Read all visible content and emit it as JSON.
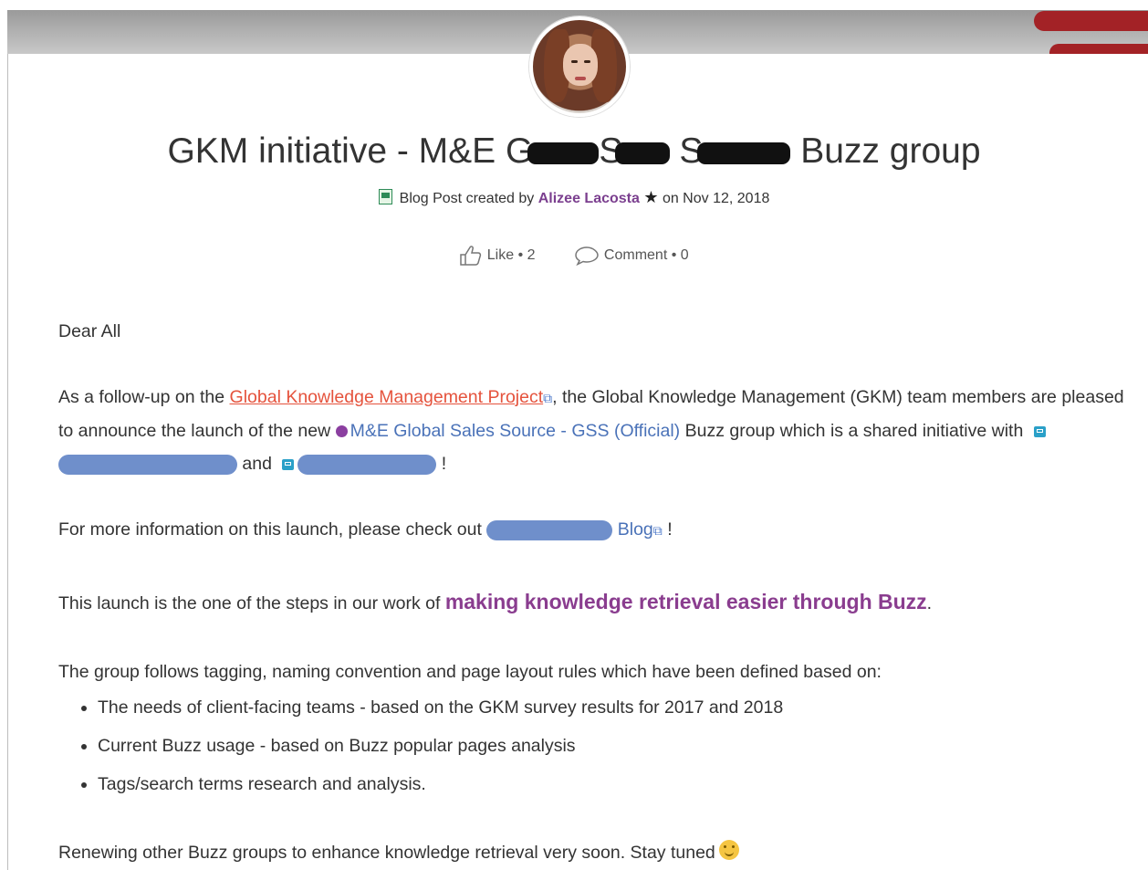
{
  "post": {
    "title_parts": [
      "GKM initiative - M&E G",
      "S",
      "S",
      " Buzz group"
    ],
    "meta_prefix": "Blog Post created by",
    "author": "Alizee Lacosta",
    "meta_date": "on Nov 12, 2018"
  },
  "social": {
    "like_label": "Like",
    "like_count": "2",
    "comment_label": "Comment",
    "comment_count": "0",
    "separator": "•"
  },
  "body": {
    "greeting": "Dear All",
    "p1_a": "As a follow-up on the ",
    "p1_link": "Global Knowledge Management Project",
    "p1_b": ", the Global Knowledge Management (GKM) team members are pleased to announce the launch of the new ",
    "p1_group": "M&E Global Sales Source - GSS (Official)",
    "p1_c": " Buzz group which is a shared initiative with ",
    "p1_and": " and ",
    "p1_end": " !",
    "p2_a": "For more information on this launch, please check out ",
    "p2_blog": "Blog",
    "p2_end": " !",
    "p3_a": "This launch is the one of the steps in our work of ",
    "p3_highlight": "making knowledge retrieval easier through Buzz",
    "p3_end": ".",
    "p4": "The group follows tagging, naming convention and page layout rules which have been defined based on:",
    "bullets": [
      "The needs of client-facing teams - based on the GKM survey results for 2017 and 2018",
      "Current Buzz usage - based on Buzz popular pages analysis",
      "Tags/search terms research and analysis."
    ],
    "p5": "Renewing other Buzz groups to enhance knowledge retrieval very soon. Stay tuned"
  },
  "icons": {
    "external": "external-link-icon",
    "like": "thumbs-up-icon",
    "comment": "speech-bubble-icon",
    "star": "star-icon",
    "blog": "document-icon",
    "group": "group-icon",
    "smiley": "smiley-icon"
  },
  "colors": {
    "author": "#7b3f8f",
    "link_external": "#e5533d",
    "link_internal": "#4a72b8",
    "highlight": "#8a3d8f",
    "banner_red": "#a32226"
  }
}
